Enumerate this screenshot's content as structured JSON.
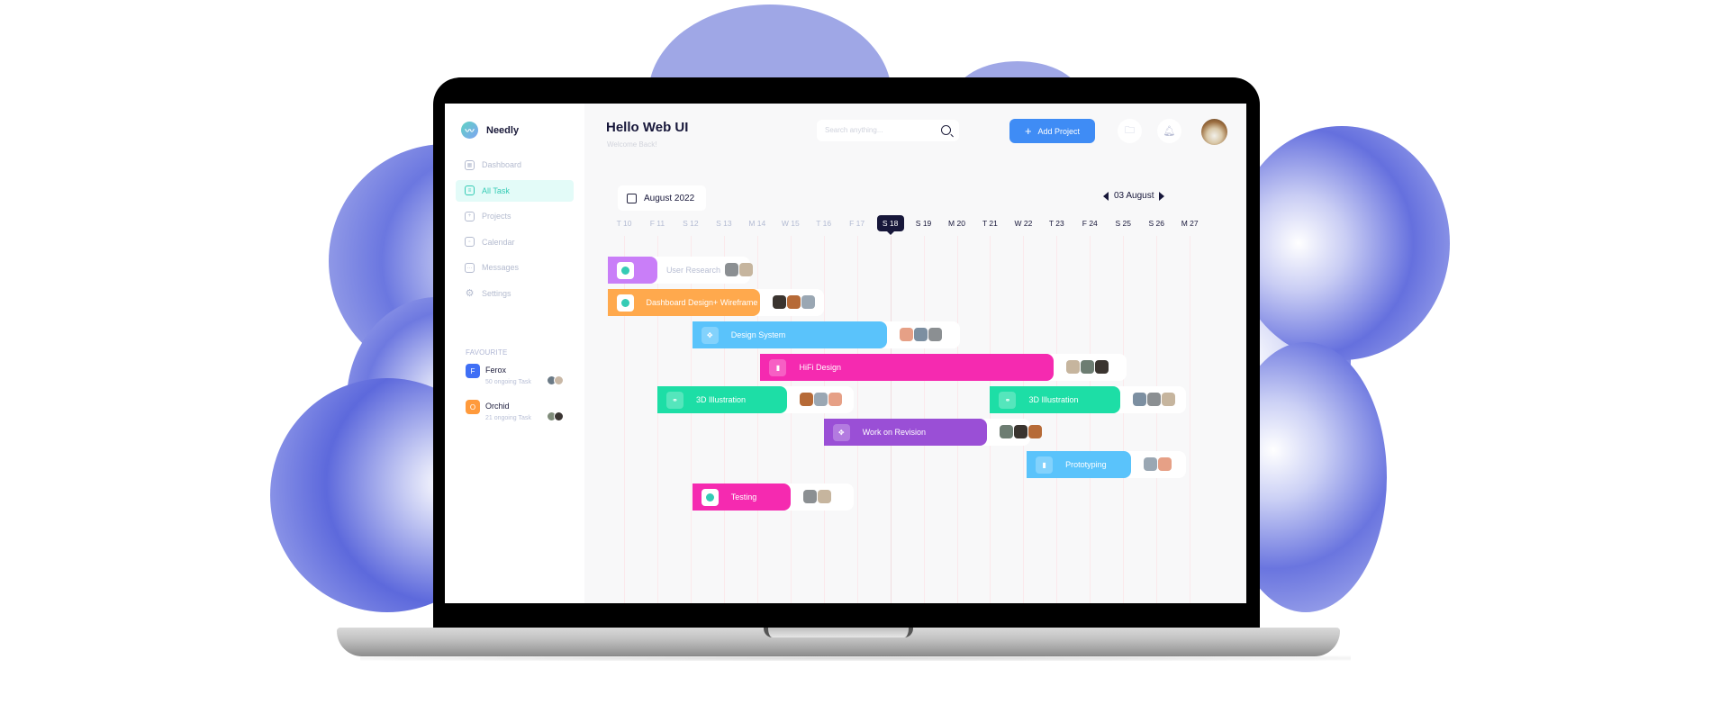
{
  "app": {
    "name": "Needly"
  },
  "sidebar": {
    "items": [
      {
        "label": "Dashboard",
        "icon": "grid-icon",
        "active": false
      },
      {
        "label": "All Task",
        "icon": "tasklist-icon",
        "active": true
      },
      {
        "label": "Projects",
        "icon": "folder-icon",
        "active": false
      },
      {
        "label": "Calendar",
        "icon": "calendar-icon",
        "active": false
      },
      {
        "label": "Messages",
        "icon": "chat-icon",
        "active": false
      },
      {
        "label": "Settings",
        "icon": "gear-icon",
        "active": false
      }
    ],
    "favourite_title": "FAVOURITE",
    "favourites": [
      {
        "badge": "F",
        "name": "Ferox",
        "sub": "50 ongoing Task",
        "color": "#3f6ff5"
      },
      {
        "badge": "O",
        "name": "Orchid",
        "sub": "21 ongoing Task",
        "color": "#ff9a3c"
      }
    ]
  },
  "header": {
    "greeting": "Hello Web UI",
    "subtitle": "Welcome Back!",
    "search_placeholder": "Search anything...",
    "add_project_label": "Add Project",
    "add_icon": "+"
  },
  "calendar": {
    "month_label": "August 2022",
    "current_date_label": "03 August",
    "days": [
      "T 10",
      "F 11",
      "S 12",
      "S 13",
      "M 14",
      "W 15",
      "T 16",
      "F 17",
      "S 18",
      "S 19",
      "M 20",
      "T 21",
      "W 22",
      "T 23",
      "F 24",
      "S 25",
      "S 26",
      "M 27"
    ],
    "today_index": 8
  },
  "tasks": [
    {
      "name": "User Research",
      "color": "#c97ef8",
      "start": -0.5,
      "bar_end": 1.0,
      "label_outside": true,
      "tail_end": 3.8,
      "icon_style": "white",
      "avatars": 2
    },
    {
      "name": "Dashboard Design+ Wireframe",
      "color": "#ffa94d",
      "start": -0.5,
      "bar_end": 4.1,
      "label_outside": false,
      "tail_end": 6.0,
      "icon_style": "white",
      "avatars": 3
    },
    {
      "name": "Design System",
      "color": "#5ac3fb",
      "start": 2.05,
      "bar_end": 7.9,
      "label_outside": false,
      "tail_end": 10.1,
      "icon_style": "glass",
      "avatars": 3
    },
    {
      "name": "HiFi Design",
      "color": "#f52ab0",
      "start": 4.1,
      "bar_end": 12.9,
      "label_outside": false,
      "tail_end": 15.1,
      "icon_style": "glass",
      "avatars": 3
    },
    {
      "name": "3D Illustration",
      "color": "#1ddea6",
      "start": 1.0,
      "bar_end": 4.9,
      "label_outside": false,
      "tail_end": 6.9,
      "icon_style": "glass",
      "avatars": 3
    },
    {
      "name": "3D Illustration",
      "color": "#1ddea6",
      "start": 11.0,
      "bar_end": 14.9,
      "label_outside": false,
      "tail_end": 16.9,
      "icon_style": "glass",
      "avatars": 3
    },
    {
      "name": "Work on Revision",
      "color": "#9a4fd6",
      "start": 6.0,
      "bar_end": 10.9,
      "label_outside": false,
      "tail_end": 12.2,
      "icon_style": "glass",
      "avatars": 3
    },
    {
      "name": "Prototyping",
      "color": "#5ac3fb",
      "start": 12.1,
      "bar_end": 15.25,
      "label_outside": false,
      "tail_end": 16.9,
      "icon_style": "glass",
      "avatars": 2
    },
    {
      "name": "Testing",
      "color": "#f52ab0",
      "start": 2.05,
      "bar_end": 5.0,
      "label_outside": false,
      "tail_end": 6.9,
      "icon_style": "white",
      "avatars": 2
    }
  ]
}
